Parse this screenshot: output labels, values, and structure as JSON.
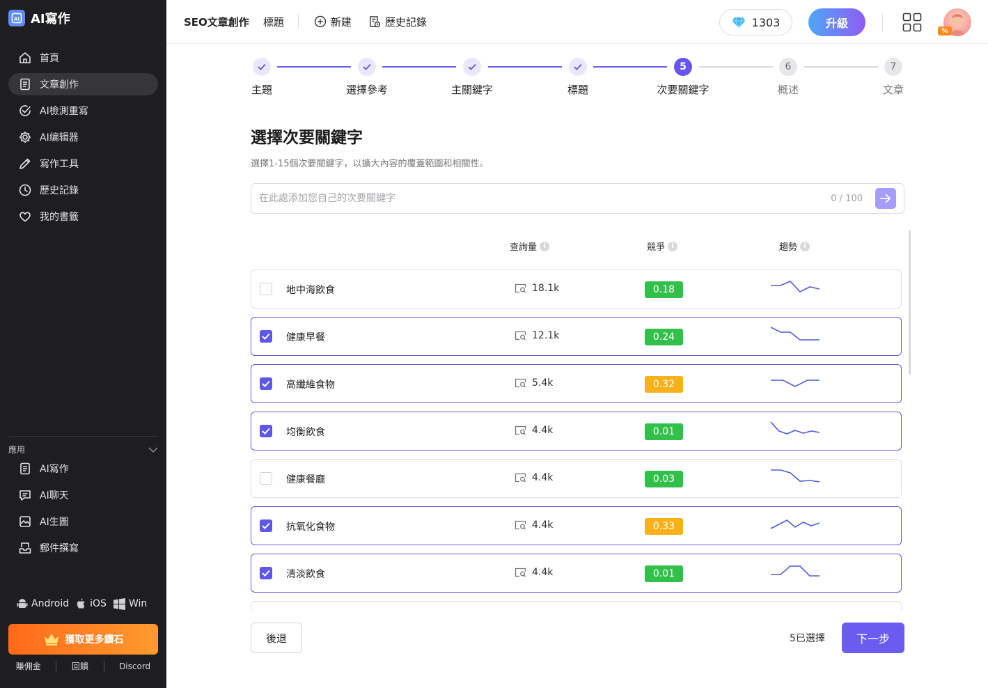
{
  "app": {
    "name": "AI寫作"
  },
  "sidebar": {
    "nav": [
      {
        "label": "首頁",
        "icon": "home-icon"
      },
      {
        "label": "文章創作",
        "icon": "document-icon",
        "active": true
      },
      {
        "label": "AI檢測重寫",
        "icon": "check-circle-icon"
      },
      {
        "label": "AI编辑器",
        "icon": "gear-icon"
      },
      {
        "label": "寫作工具",
        "icon": "pen-icon"
      },
      {
        "label": "歷史記錄",
        "icon": "clock-icon"
      },
      {
        "label": "我的書籤",
        "icon": "heart-icon"
      }
    ],
    "apps_label": "應用",
    "apps": [
      {
        "label": "AI寫作",
        "icon": "document-icon"
      },
      {
        "label": "AI聊天",
        "icon": "chat-icon"
      },
      {
        "label": "AI生圖",
        "icon": "image-icon"
      },
      {
        "label": "郵件撰寫",
        "icon": "mail-tray-icon"
      }
    ],
    "platforms": [
      "Android",
      "iOS",
      "Win"
    ],
    "cta_label": "獲取更多鑽石",
    "footer_links": [
      "賺佣金",
      "回饋",
      "Discord"
    ]
  },
  "header": {
    "title": "SEO文章創作",
    "subtitle": "標題",
    "new_label": "新建",
    "history_label": "歷史記錄",
    "diamonds": "1303",
    "upgrade_label": "升級",
    "avatar_badge": "%"
  },
  "stepper": {
    "steps": [
      {
        "mark": "",
        "label": "主題",
        "state": "done"
      },
      {
        "mark": "",
        "label": "選擇參考",
        "state": "done"
      },
      {
        "mark": "",
        "label": "主關鍵字",
        "state": "done"
      },
      {
        "mark": "",
        "label": "標題",
        "state": "done"
      },
      {
        "mark": "5",
        "label": "次要關鍵字",
        "state": "current"
      },
      {
        "mark": "6",
        "label": "概述",
        "state": "todo"
      },
      {
        "mark": "7",
        "label": "文章",
        "state": "todo"
      }
    ]
  },
  "main": {
    "title": "選擇次要關鍵字",
    "subtitle": "選擇1-15個次要關鍵字，以擴大內容的覆蓋範圍和相關性。",
    "input": {
      "placeholder": "在此處添加您自己的次要關鍵字",
      "value": "",
      "counter": "0 / 100"
    },
    "columns": {
      "volume": "查詢量",
      "competition": "競爭",
      "trend": "趨勢"
    },
    "rows": [
      {
        "keyword": "地中海飲食",
        "volume": "18.1k",
        "competition": "0.18",
        "level": "green",
        "checked": false,
        "trend": [
          0.55,
          0.55,
          0.85,
          0.1,
          0.45,
          0.3
        ]
      },
      {
        "keyword": "健康早餐",
        "volume": "12.1k",
        "competition": "0.24",
        "level": "green",
        "checked": true,
        "trend": [
          0.95,
          0.6,
          0.6,
          0.05,
          0.05,
          0.05
        ]
      },
      {
        "keyword": "高纖維食物",
        "volume": "5.4k",
        "competition": "0.32",
        "level": "amber",
        "checked": true,
        "trend": [
          0.55,
          0.55,
          0.1,
          0.55,
          0.55
        ]
      },
      {
        "keyword": "均衡飲食",
        "volume": "4.4k",
        "competition": "0.01",
        "level": "green",
        "checked": true,
        "trend": [
          0.95,
          0.3,
          0.1,
          0.35,
          0.15,
          0.3,
          0.2
        ]
      },
      {
        "keyword": "健康餐廳",
        "volume": "4.4k",
        "competition": "0.03",
        "level": "green",
        "checked": false,
        "trend": [
          0.9,
          0.9,
          0.7,
          0.1,
          0.15,
          0.05
        ]
      },
      {
        "keyword": "抗氧化食物",
        "volume": "4.4k",
        "competition": "0.33",
        "level": "amber",
        "checked": true,
        "trend": [
          0.1,
          0.4,
          0.7,
          0.2,
          0.55,
          0.3,
          0.5
        ]
      },
      {
        "keyword": "清淡飲食",
        "volume": "4.4k",
        "competition": "0.01",
        "level": "green",
        "checked": true,
        "trend": [
          0.2,
          0.2,
          0.8,
          0.8,
          0.1,
          0.1
        ]
      },
      {
        "keyword": "",
        "volume": "",
        "competition": "",
        "level": "green",
        "checked": false,
        "trend": []
      }
    ],
    "back_label": "後退",
    "selected_count": "5已選擇",
    "next_label": "下一步"
  },
  "colors": {
    "accent": "#6656ee",
    "green": "#33c04a",
    "amber": "#f7b21b",
    "trend": "#4f5bd5"
  }
}
